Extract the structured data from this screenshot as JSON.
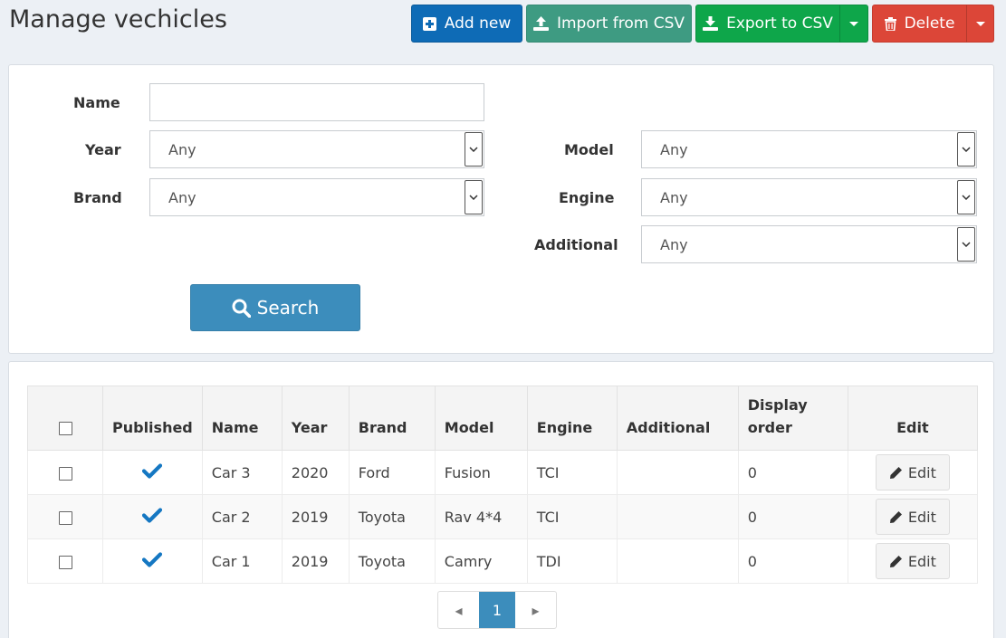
{
  "header": {
    "title": "Manage vechicles"
  },
  "toolbar": {
    "add_new": "Add new",
    "import_csv": "Import from CSV",
    "export_csv": "Export to CSV",
    "delete": "Delete"
  },
  "filters": {
    "name": {
      "label": "Name",
      "value": ""
    },
    "year": {
      "label": "Year",
      "value": "Any"
    },
    "brand": {
      "label": "Brand",
      "value": "Any"
    },
    "model": {
      "label": "Model",
      "value": "Any"
    },
    "engine": {
      "label": "Engine",
      "value": "Any"
    },
    "additional": {
      "label": "Additional",
      "value": "Any"
    },
    "search_button": "Search"
  },
  "table": {
    "columns": [
      "Published",
      "Name",
      "Year",
      "Brand",
      "Model",
      "Engine",
      "Additional",
      "Display order",
      "Edit"
    ],
    "rows": [
      {
        "published": true,
        "name": "Car 3",
        "year": "2020",
        "brand": "Ford",
        "model": "Fusion",
        "engine": "TCI",
        "additional": "",
        "display_order": "0",
        "edit": "Edit"
      },
      {
        "published": true,
        "name": "Car 2",
        "year": "2019",
        "brand": "Toyota",
        "model": "Rav 4*4",
        "engine": "TCI",
        "additional": "",
        "display_order": "0",
        "edit": "Edit"
      },
      {
        "published": true,
        "name": "Car 1",
        "year": "2019",
        "brand": "Toyota",
        "model": "Camry",
        "engine": "TDI",
        "additional": "",
        "display_order": "0",
        "edit": "Edit"
      }
    ]
  },
  "pagination": {
    "prev": "◂",
    "current": "1",
    "next": "▸"
  },
  "colors": {
    "primary": "#0e6bb6",
    "import": "#3e9b82",
    "export": "#0ea64a",
    "delete": "#dc4638",
    "search": "#3c8dbc",
    "check": "#1577c2"
  }
}
